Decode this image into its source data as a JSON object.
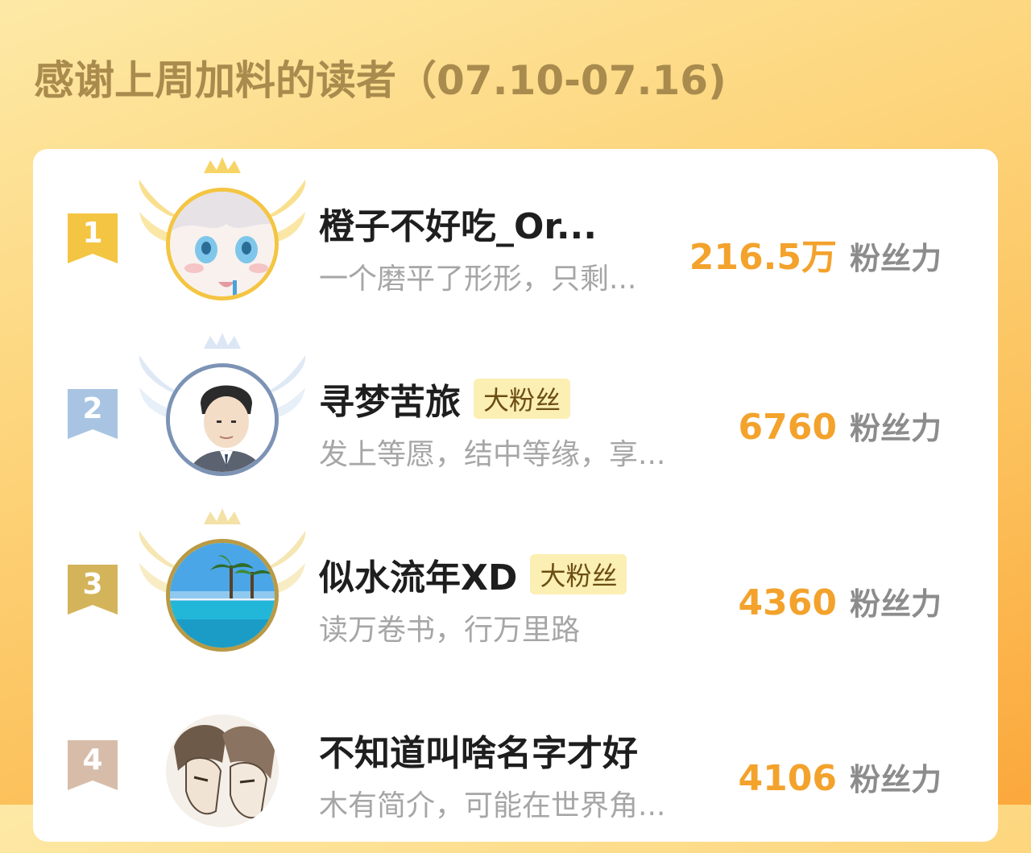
{
  "header": {
    "title": "感谢上周加料的读者（07.10-07.16)"
  },
  "colors": {
    "gold": "#f4c542",
    "silver": "#a9c4e3",
    "bronze": "#d4b45a",
    "fourth": "#d7bda9",
    "power_value": "#f3a22c"
  },
  "readers": [
    {
      "rank": "1",
      "name": "橙子不好吃_Or...",
      "badge": "",
      "bio": "一个磨平了形形，只剩...",
      "power_value": "216.5万",
      "power_unit": "粉丝力",
      "avatar_icon": "anime-girl-avatar"
    },
    {
      "rank": "2",
      "name": "寻梦苦旅",
      "badge": "大粉丝",
      "bio": "发上等愿，结中等缘，享...",
      "power_value": "6760",
      "power_unit": "粉丝力",
      "avatar_icon": "suit-man-avatar"
    },
    {
      "rank": "3",
      "name": "似水流年XD",
      "badge": "大粉丝",
      "bio": "读万卷书，行万里路",
      "power_value": "4360",
      "power_unit": "粉丝力",
      "avatar_icon": "beach-pool-avatar"
    },
    {
      "rank": "4",
      "name": "不知道叫啥名字才好",
      "badge": "",
      "bio": "木有简介，可能在世界角...",
      "power_value": "4106",
      "power_unit": "粉丝力",
      "avatar_icon": "sketch-characters-avatar"
    }
  ]
}
